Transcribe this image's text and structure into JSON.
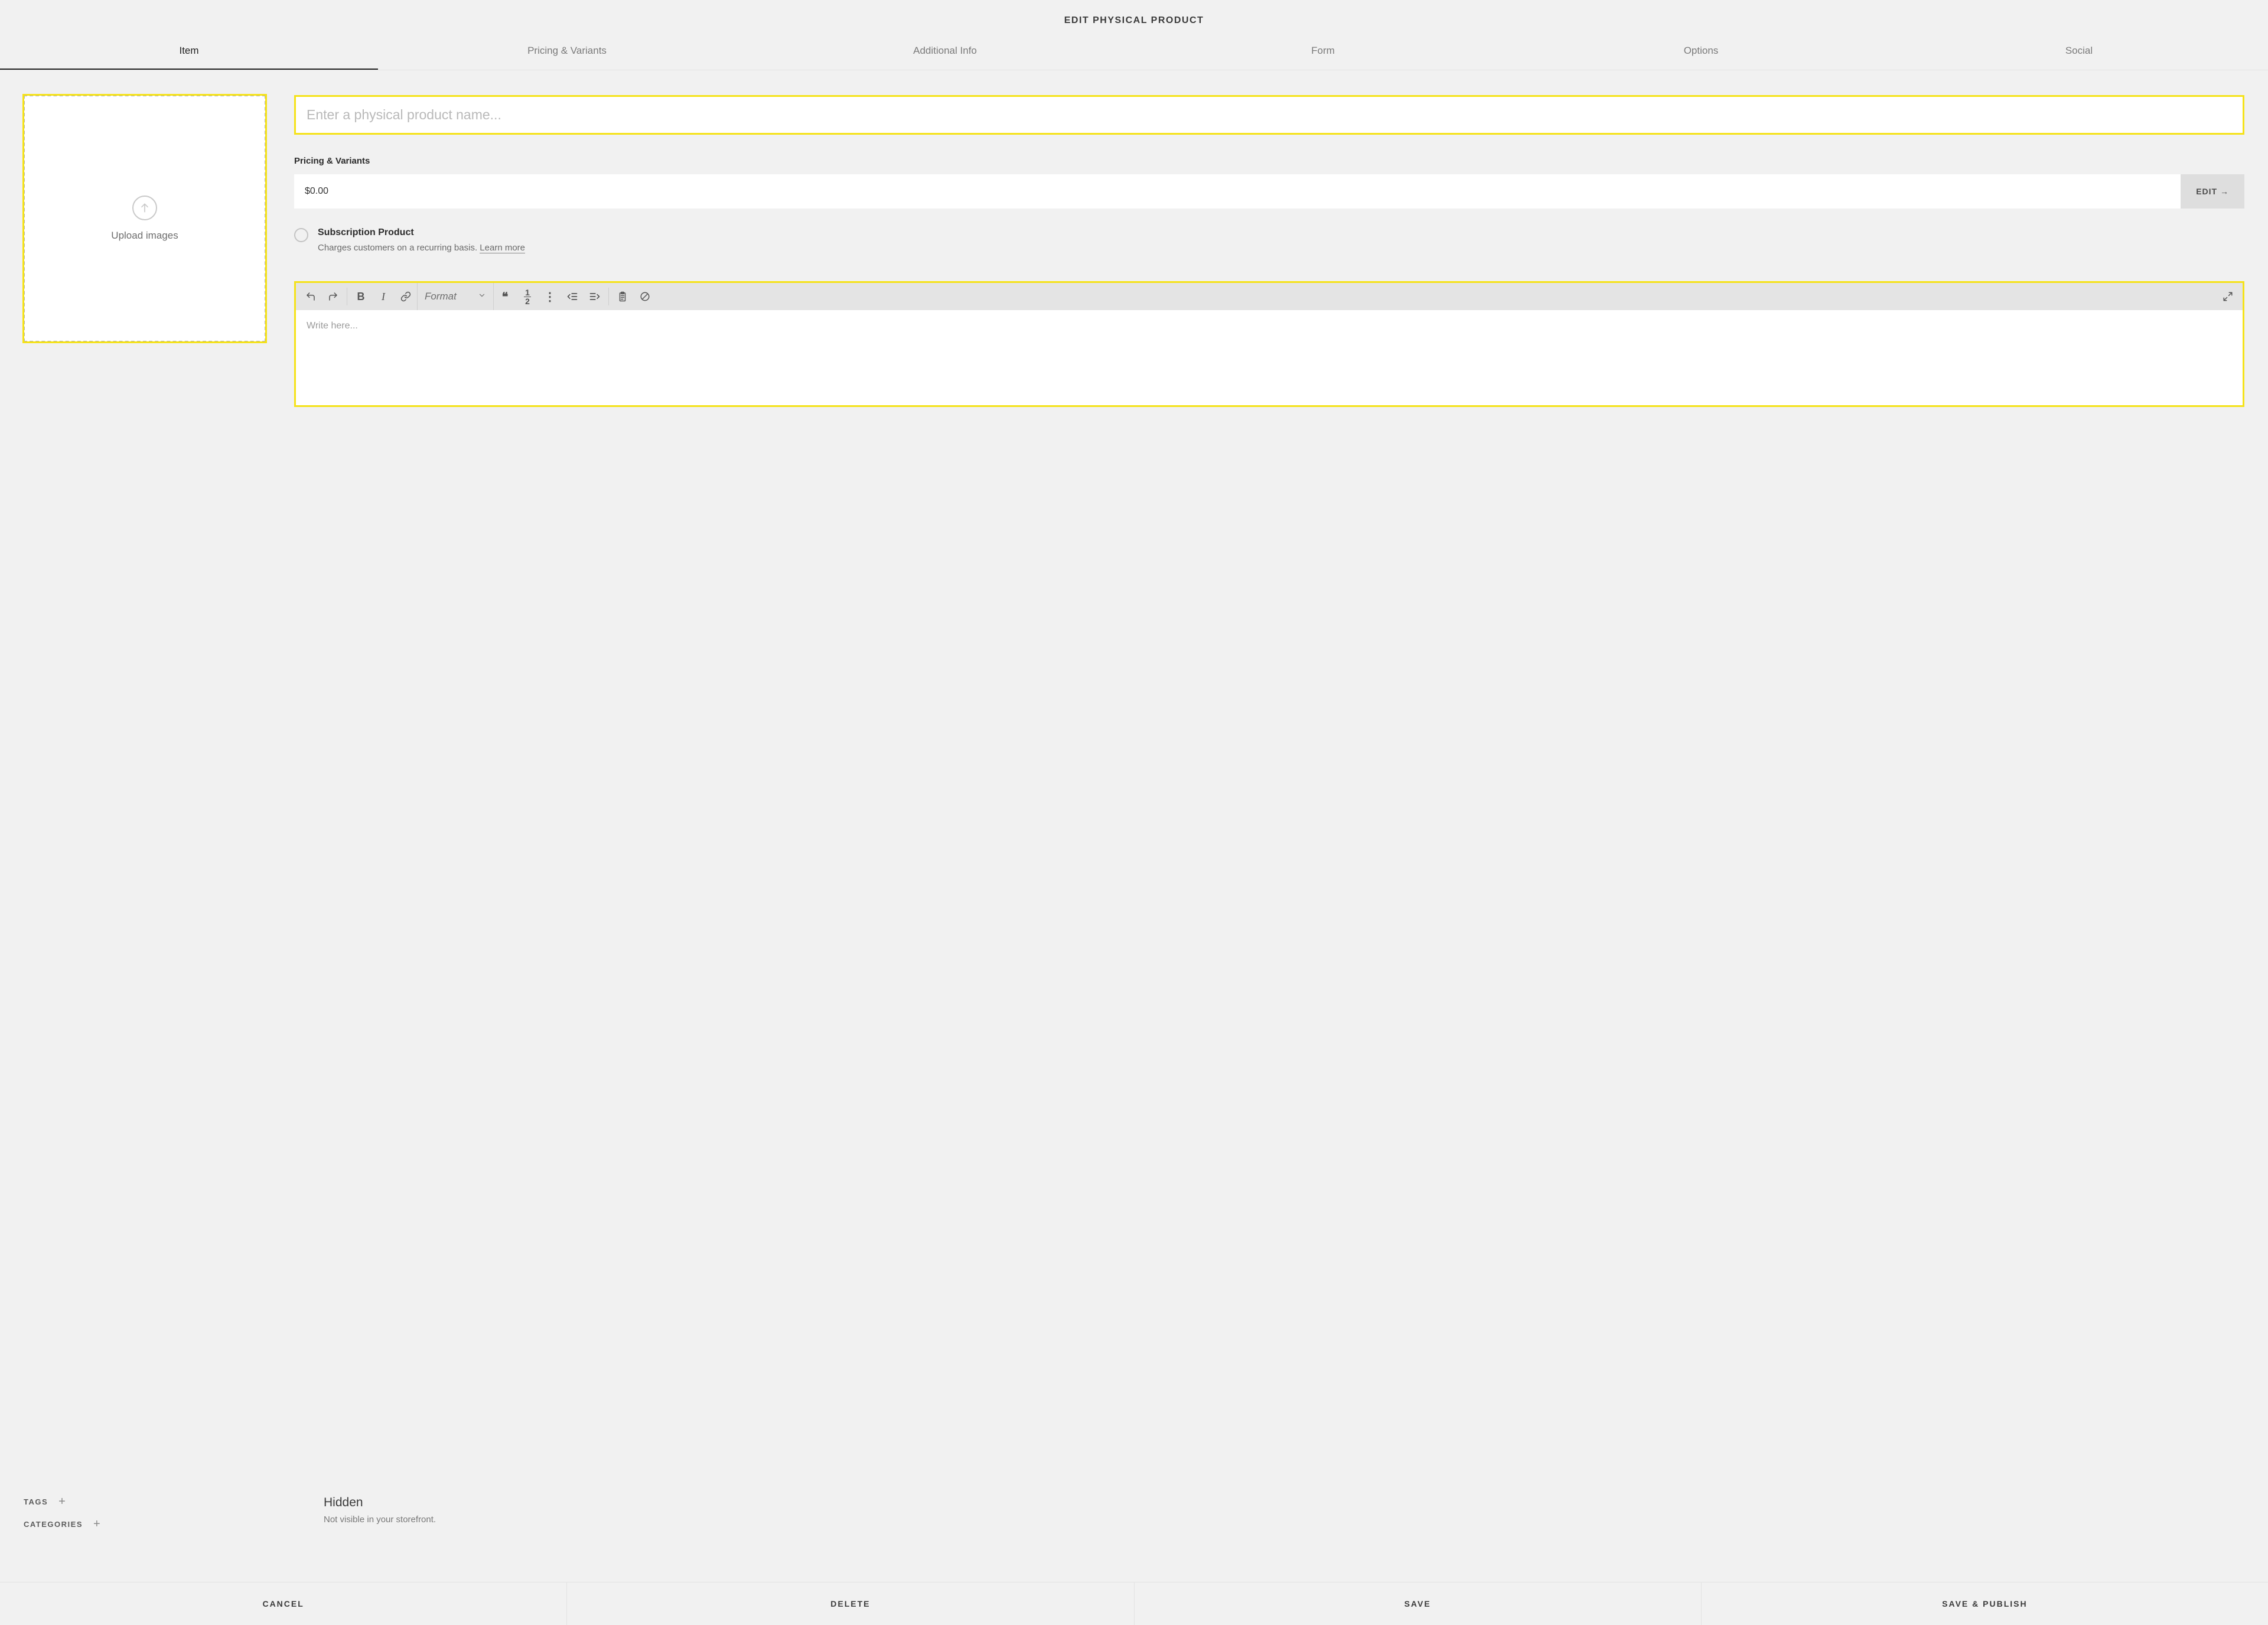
{
  "header": {
    "title": "EDIT PHYSICAL PRODUCT"
  },
  "tabs": [
    {
      "label": "Item",
      "active": true
    },
    {
      "label": "Pricing & Variants"
    },
    {
      "label": "Additional Info"
    },
    {
      "label": "Form"
    },
    {
      "label": "Options"
    },
    {
      "label": "Social"
    }
  ],
  "upload": {
    "label": "Upload images"
  },
  "name": {
    "placeholder": "Enter a physical product name..."
  },
  "pricing": {
    "section_label": "Pricing & Variants",
    "value": "$0.00",
    "edit_label": "EDIT →"
  },
  "subscription": {
    "title": "Subscription Product",
    "desc_prefix": "Charges customers on a recurring basis. ",
    "learn_more": "Learn more"
  },
  "editor": {
    "format_label": "Format",
    "placeholder": "Write here..."
  },
  "meta": {
    "tags_label": "TAGS",
    "categories_label": "CATEGORIES",
    "visibility_title": "Hidden",
    "visibility_desc": "Not visible in your storefront."
  },
  "footer": {
    "cancel": "CANCEL",
    "delete": "DELETE",
    "save": "SAVE",
    "save_publish": "SAVE & PUBLISH"
  }
}
